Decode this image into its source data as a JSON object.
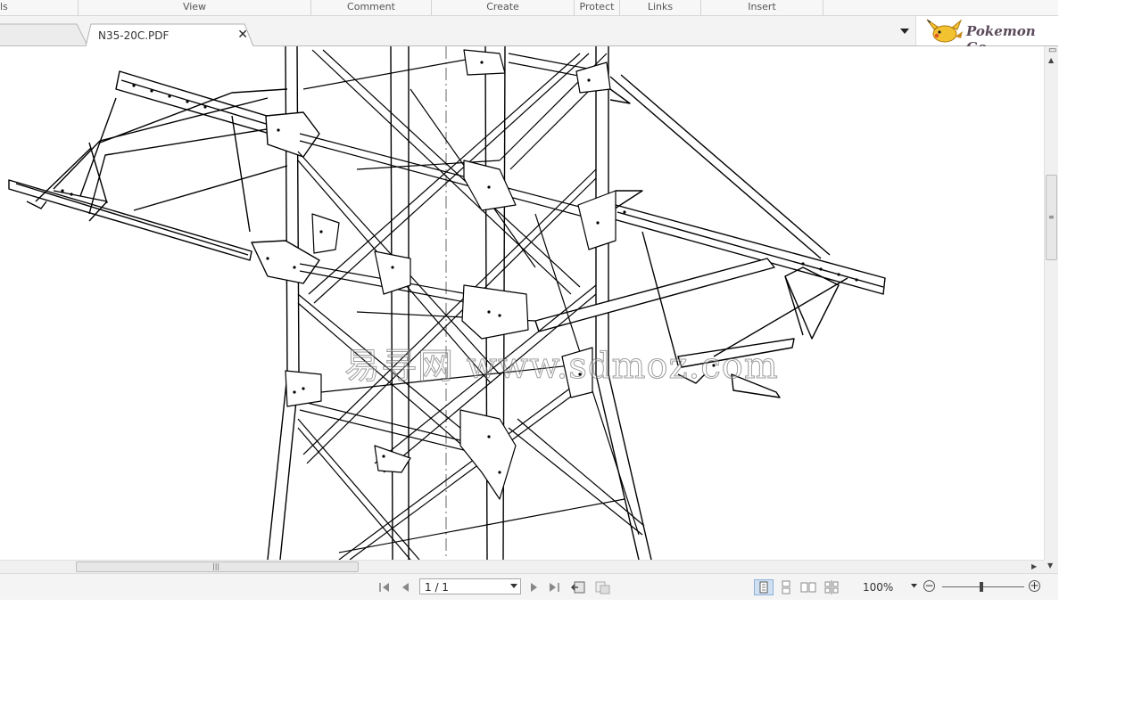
{
  "menubar": {
    "items": [
      "ls",
      "View",
      "Comment",
      "Create",
      "Protect",
      "Links",
      "Insert"
    ]
  },
  "tabs": {
    "active_document": "N35-20C.PDF"
  },
  "brand": {
    "text": "Pokemon Go"
  },
  "document": {
    "watermark": "易寻网 www.sdmoz.com"
  },
  "statusbar": {
    "page_indicator": "1 / 1",
    "zoom": "100%",
    "zoom_slider_fraction": 0.48
  },
  "colors": {
    "chrome_background": "#f4f4f4",
    "drawing_line": "#000000"
  },
  "icons": [
    "first-page-icon",
    "previous-page-icon",
    "next-page-icon",
    "last-page-icon",
    "previous-view-icon",
    "next-view-icon",
    "single-page-icon",
    "continuous-icon",
    "facing-icon",
    "continuous-facing-icon",
    "zoom-out-icon",
    "zoom-in-icon",
    "tab-list-dropdown-icon",
    "close-icon"
  ]
}
